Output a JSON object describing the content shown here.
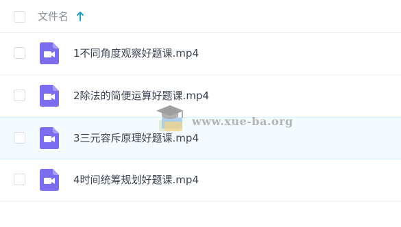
{
  "header": {
    "column_label": "文件名",
    "sort_direction": "ascending"
  },
  "files": [
    {
      "name": "1不同角度观察好题课.mp4",
      "icon": "video-file-icon"
    },
    {
      "name": "2除法的简便运算好题课.mp4",
      "icon": "video-file-icon"
    },
    {
      "name": "3三元容斥原理好题课.mp4",
      "icon": "video-file-icon",
      "highlighted": true
    },
    {
      "name": "4时间统筹规划好题课.mp4",
      "icon": "video-file-icon"
    }
  ],
  "watermark": {
    "text": "www.xue-ba.org"
  },
  "colors": {
    "accent": "#1f9fd8",
    "video_icon": "#7b6cf0",
    "row_highlight": "#f4fbfe"
  }
}
